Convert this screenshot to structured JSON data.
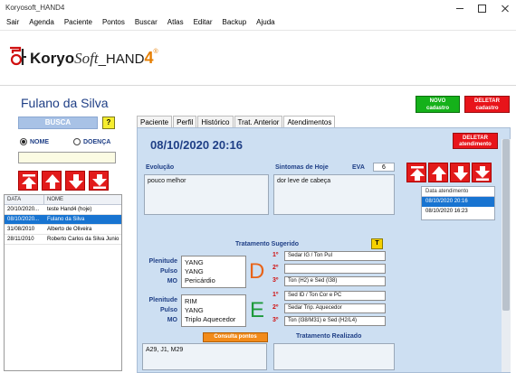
{
  "window": {
    "title": "Koryosoft_HAND4"
  },
  "menu": [
    "Sair",
    "Agenda",
    "Paciente",
    "Pontos",
    "Buscar",
    "Atlas",
    "Editar",
    "Backup",
    "Ajuda"
  ],
  "logo": {
    "koryo": "Koryo",
    "soft": "Soft",
    "hand": "_HAND",
    "four": "4",
    "reg": "®"
  },
  "patient": {
    "name": "Fulano da Silva"
  },
  "search": {
    "busca_label": "BUSCA",
    "help_label": "?",
    "radio_nome": "NOME",
    "radio_doenca": "DOENÇA",
    "selected": "NOME",
    "value": ""
  },
  "patient_table": {
    "headers": [
      "DATA",
      "NOME"
    ],
    "rows": [
      [
        "20/10/2020...",
        "teste Hand4 (hoje)"
      ],
      [
        "08/10/2020...",
        "Fulano da Silva"
      ],
      [
        "31/08/2010",
        "Alberto de Oliveira"
      ],
      [
        "28/11/2010",
        "Roberto Carlos da Silva Junio"
      ]
    ],
    "selected_index": 1
  },
  "top_buttons": {
    "novo": [
      "NOVO",
      "cadastro"
    ],
    "deletar": [
      "DELETAR",
      "cadastro"
    ]
  },
  "tabs": [
    "Paciente",
    "Perfil",
    "Histórico",
    "Trat. Anterior",
    "Atendimentos"
  ],
  "active_tab": "Atendimentos",
  "atendimento": {
    "datetime": "08/10/2020 20:16",
    "deletar_button": [
      "DELETAR",
      "atendimento"
    ],
    "evolucao_label": "Evolução",
    "evolucao_text": "pouco melhor",
    "sintomas_label": "Sintomas de Hoje",
    "sintomas_text": "dor leve de cabeça",
    "eva_label": "EVA",
    "eva_value": "6",
    "list_header": "Data atendimento",
    "list_items": [
      "08/10/2020 20:16",
      "08/10/2020 16:23"
    ],
    "list_selected": 0,
    "tratamento_sugerido_label": "Tratamento Sugerido",
    "t_button": "T",
    "group_d": {
      "labels": [
        "Plenitude",
        "Pulso",
        "MO"
      ],
      "values": [
        "YANG",
        "YANG",
        "Pericárdio"
      ],
      "letter": "D",
      "letter_color": "#e8641a",
      "points": [
        "Sedar IG / Ton Pul",
        "",
        "Ton (H2) e Sed (I38)"
      ]
    },
    "group_e": {
      "labels": [
        "Plenitude",
        "Pulso",
        "MO"
      ],
      "values": [
        "RIM",
        "YANG",
        "Triplo Aquecedor"
      ],
      "letter": "E",
      "letter_color": "#1e9a3c",
      "points": [
        "Sed ID / Ton Cor e PC",
        "Sedar Trip. Aquecedor",
        "Ton (I38/M31) e Sed (H2/L4)"
      ]
    },
    "ordinals": [
      "1º",
      "2º",
      "3º"
    ],
    "consulta_button": "Consulta pontos",
    "tratamento_realizado_label": "Tratamento Realizado",
    "points_text": "A29, J1, M29"
  },
  "colors": {
    "accent_blue": "#1f3f86",
    "red_button": "#e21b1b",
    "panel_bg": "#cddff2",
    "selection": "#1874d1"
  }
}
